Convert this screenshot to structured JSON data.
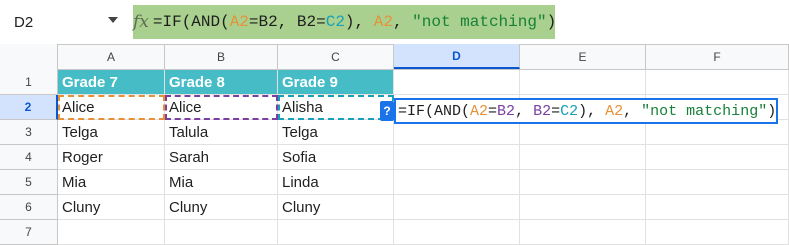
{
  "name_box": {
    "value": "D2"
  },
  "formula_bar": {
    "fx_label": "fx",
    "tokens": [
      {
        "t": "=IF(AND(",
        "k": "plain"
      },
      {
        "t": "A2",
        "k": "ref-a"
      },
      {
        "t": "=B2, B2=",
        "k": "plain"
      },
      {
        "t": "C2",
        "k": "ref-c"
      },
      {
        "t": "), ",
        "k": "plain"
      },
      {
        "t": "A2",
        "k": "ref-a"
      },
      {
        "t": ", ",
        "k": "plain"
      },
      {
        "t": "\"not matching\"",
        "k": "str"
      },
      {
        "t": ")",
        "k": "plain"
      }
    ]
  },
  "editor": {
    "tokens": [
      {
        "t": "=IF(AND(",
        "k": "plain"
      },
      {
        "t": "A2",
        "k": "ref-a"
      },
      {
        "t": "=",
        "k": "plain"
      },
      {
        "t": "B2",
        "k": "ref-b"
      },
      {
        "t": ", ",
        "k": "plain"
      },
      {
        "t": "B2",
        "k": "ref-b"
      },
      {
        "t": "=",
        "k": "plain"
      },
      {
        "t": "C2",
        "k": "ref-c"
      },
      {
        "t": "), ",
        "k": "plain"
      },
      {
        "t": "A2",
        "k": "ref-a"
      },
      {
        "t": ", ",
        "k": "plain"
      },
      {
        "t": "\"not matching\"",
        "k": "str"
      },
      {
        "t": ")",
        "k": "plain"
      }
    ],
    "help_label": "?"
  },
  "columns": [
    "A",
    "B",
    "C",
    "D",
    "E",
    "F"
  ],
  "selected_column": "D",
  "rows": [
    "1",
    "2",
    "3",
    "4",
    "5",
    "6",
    "7"
  ],
  "selected_row": "2",
  "headers": [
    "Grade 7",
    "Grade 8",
    "Grade 9"
  ],
  "data": [
    [
      "Alice",
      "Alice",
      "Alisha"
    ],
    [
      "Telga",
      "Talula",
      "Telga"
    ],
    [
      "Roger",
      "Sarah",
      "Sofia"
    ],
    [
      "Mia",
      "Mia",
      "Linda"
    ],
    [
      "Cluny",
      "Cluny",
      "Cluny"
    ]
  ],
  "colors": {
    "header_fill": "#46bdc6",
    "formula_bar_fill": "#a9d08e",
    "ref_a": "#e69138",
    "ref_b": "#7b3fa0",
    "ref_c": "#18a0b8",
    "string": "#188038",
    "active_border": "#1a73e8"
  }
}
